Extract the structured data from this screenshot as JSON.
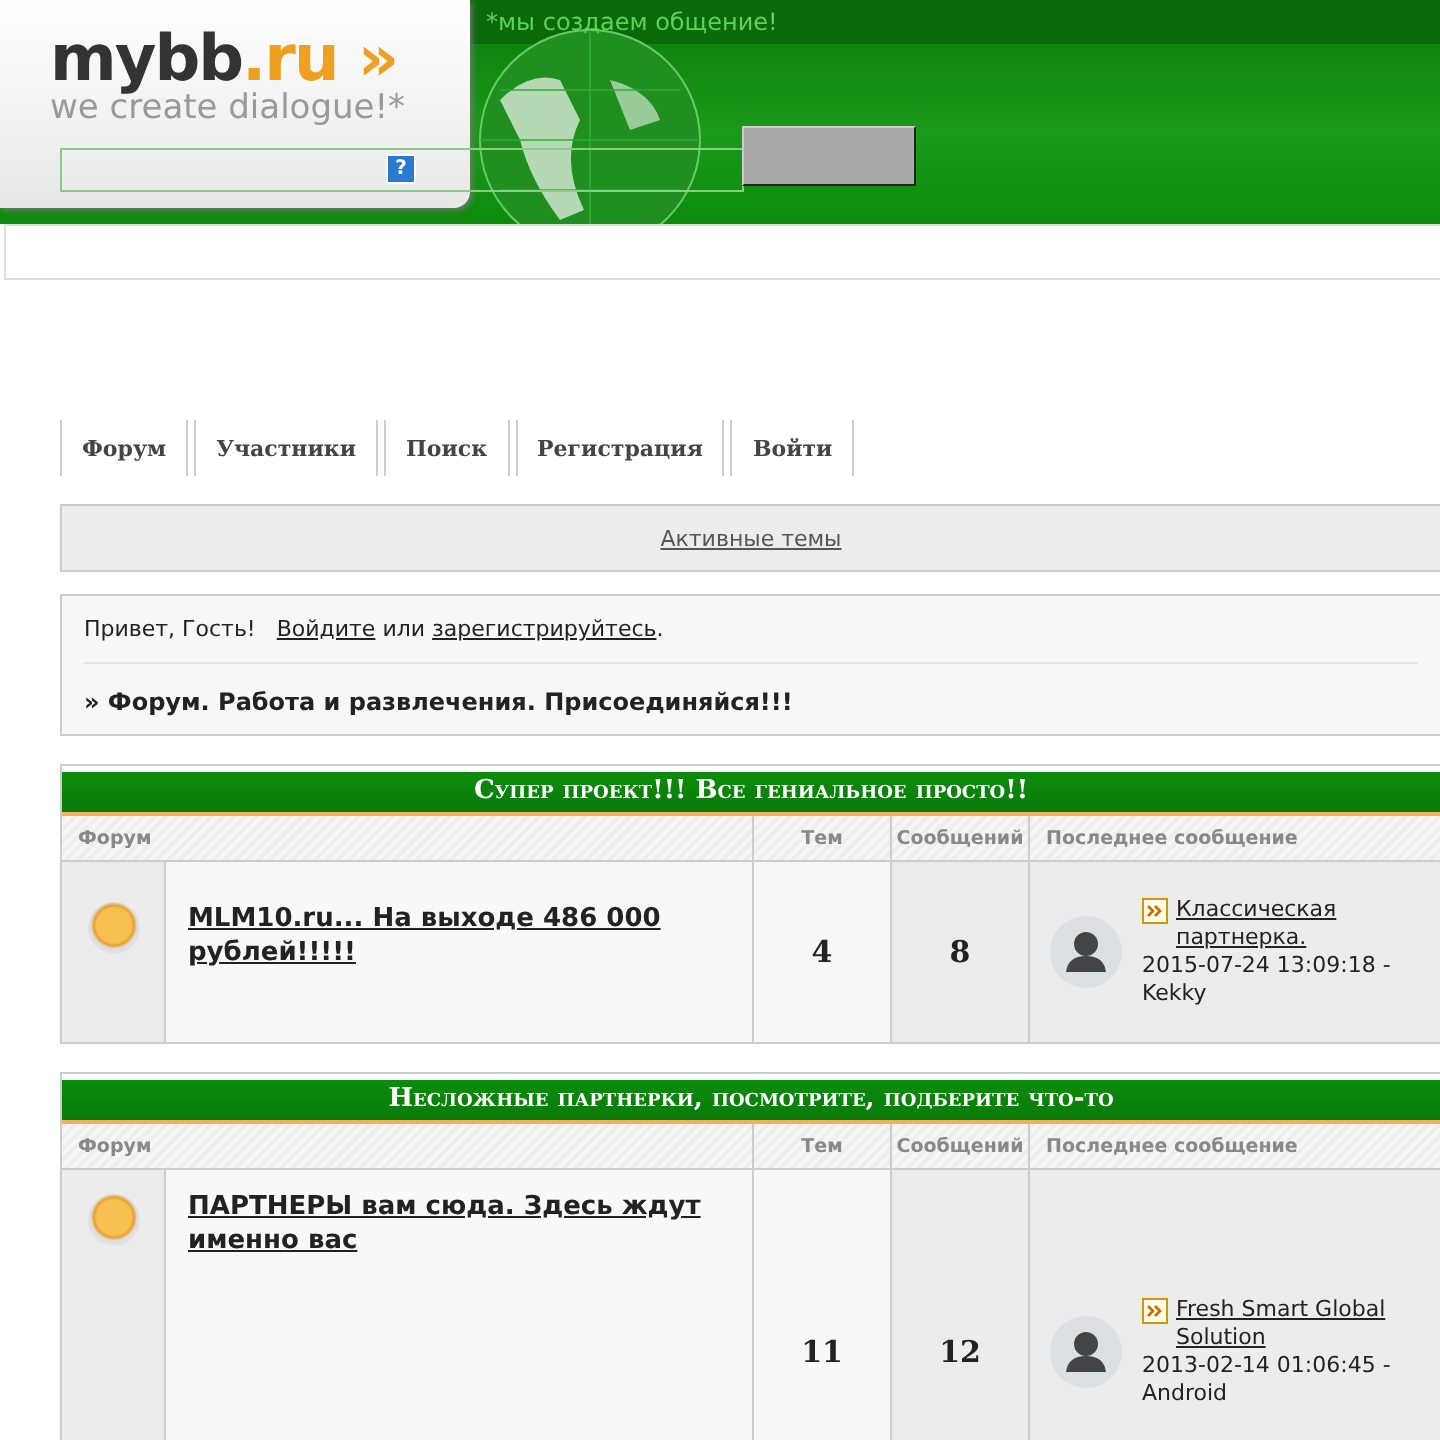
{
  "header": {
    "tagline": "*мы создаем общение!",
    "logo": {
      "name": "mybb",
      "tld": ".ru",
      "arrows": "»",
      "slogan": "we  create dialogue!*"
    },
    "search": {
      "help": "?"
    }
  },
  "nav": [
    {
      "label": "Форум"
    },
    {
      "label": "Участники"
    },
    {
      "label": "Поиск"
    },
    {
      "label": "Регистрация"
    },
    {
      "label": "Войти"
    }
  ],
  "active_topics": "Активные темы",
  "welcome": {
    "greeting": "Привет, Гость!",
    "login": "Войдите",
    "or": "или",
    "register": "зарегистрируйтесь",
    "end": ".",
    "announcement": "» Форум. Работа и развлечения. Присоединяйся!!!"
  },
  "categories": [
    {
      "title": "Супер проект!!! Все гениальное просто!!",
      "columns": [
        "Форум",
        "Тем",
        "Сообщений",
        "Последнее сообщение"
      ],
      "forums": [
        {
          "title": "MLM10.ru... На выходе 486 000 рублей!!!!!",
          "topics": "4",
          "posts": "8",
          "last_post": {
            "title": "Классическая партнерка.",
            "date": "2015-07-24 13:09:18 -",
            "author": "Kekky"
          },
          "tall": false
        }
      ]
    },
    {
      "title": "Несложные партнерки, посмотрите, подберите что-то",
      "columns": [
        "Форум",
        "Тем",
        "Сообщений",
        "Последнее сообщение"
      ],
      "forums": [
        {
          "title": "ПАРТНЕРЫ вам сюда. Здесь ждут именно вас",
          "topics": "11",
          "posts": "12",
          "last_post": {
            "title": "Fresh Smart Global Solution",
            "date": "2013-02-14 01:06:45 -",
            "author": "Android"
          },
          "tall": true
        }
      ]
    }
  ]
}
